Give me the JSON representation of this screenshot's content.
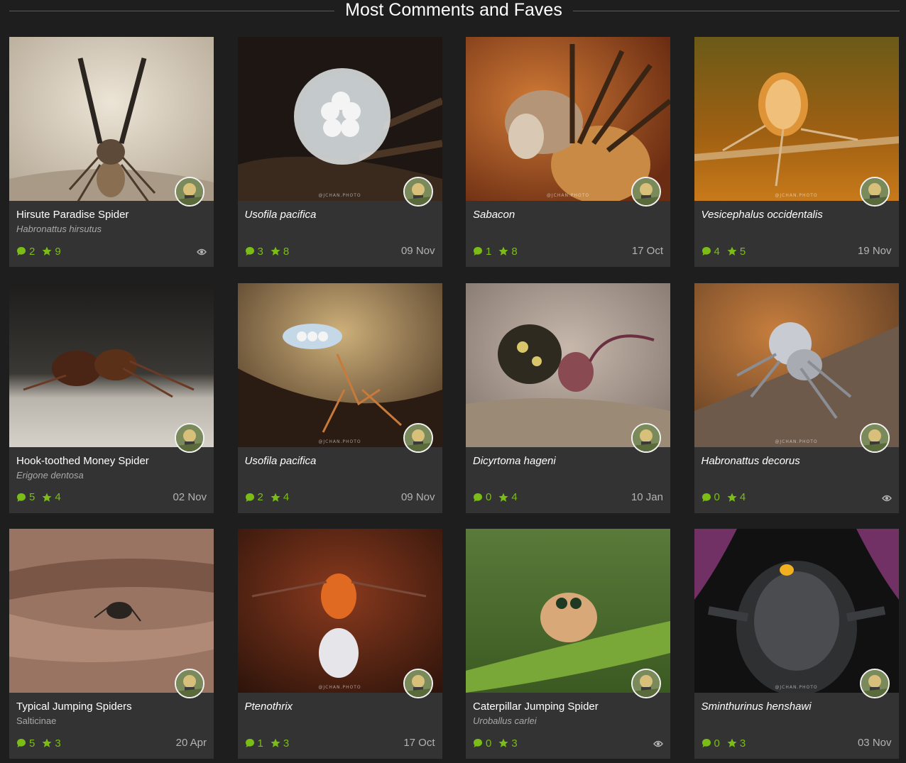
{
  "header": {
    "title": "Most Comments and Faves"
  },
  "colors": {
    "accent": "#7bbd16",
    "card_bg": "#333333",
    "page_bg": "#1e1e1e"
  },
  "watermark": "@JCHAN.PHOTO",
  "cards": [
    {
      "title": "Hirsute Paradise Spider",
      "title_italic": false,
      "subtitle": "Habronattus hirsutus",
      "comments": "2",
      "faves": "9",
      "date": "",
      "icon": "eye-icon"
    },
    {
      "title": "Usofila pacifica",
      "title_italic": true,
      "subtitle": "",
      "comments": "3",
      "faves": "8",
      "date": "09 Nov",
      "icon": ""
    },
    {
      "title": "Sabacon",
      "title_italic": true,
      "subtitle": "",
      "comments": "1",
      "faves": "8",
      "date": "17 Oct",
      "icon": ""
    },
    {
      "title": "Vesicephalus occidentalis",
      "title_italic": true,
      "subtitle": "",
      "comments": "4",
      "faves": "5",
      "date": "19 Nov",
      "icon": ""
    },
    {
      "title": "Hook-toothed Money Spider",
      "title_italic": false,
      "subtitle": "Erigone dentosa",
      "comments": "5",
      "faves": "4",
      "date": "02 Nov",
      "icon": ""
    },
    {
      "title": "Usofila pacifica",
      "title_italic": true,
      "subtitle": "",
      "comments": "2",
      "faves": "4",
      "date": "09 Nov",
      "icon": ""
    },
    {
      "title": "Dicyrtoma hageni",
      "title_italic": true,
      "subtitle": "",
      "comments": "0",
      "faves": "4",
      "date": "10 Jan",
      "icon": ""
    },
    {
      "title": "Habronattus decorus",
      "title_italic": true,
      "subtitle": "",
      "comments": "0",
      "faves": "4",
      "date": "",
      "icon": "eye-icon"
    },
    {
      "title": "Typical Jumping Spiders",
      "title_italic": false,
      "subtitle": "Salticinae",
      "subtitle_italic": false,
      "comments": "5",
      "faves": "3",
      "date": "20 Apr",
      "icon": ""
    },
    {
      "title": "Ptenothrix",
      "title_italic": true,
      "subtitle": "",
      "comments": "1",
      "faves": "3",
      "date": "17 Oct",
      "icon": ""
    },
    {
      "title": "Caterpillar Jumping Spider",
      "title_italic": false,
      "subtitle": "Uroballus carlei",
      "comments": "0",
      "faves": "3",
      "date": "",
      "icon": "eye-icon"
    },
    {
      "title": "Sminthurinus henshawi",
      "title_italic": true,
      "subtitle": "",
      "comments": "0",
      "faves": "3",
      "date": "03 Nov",
      "icon": ""
    }
  ]
}
